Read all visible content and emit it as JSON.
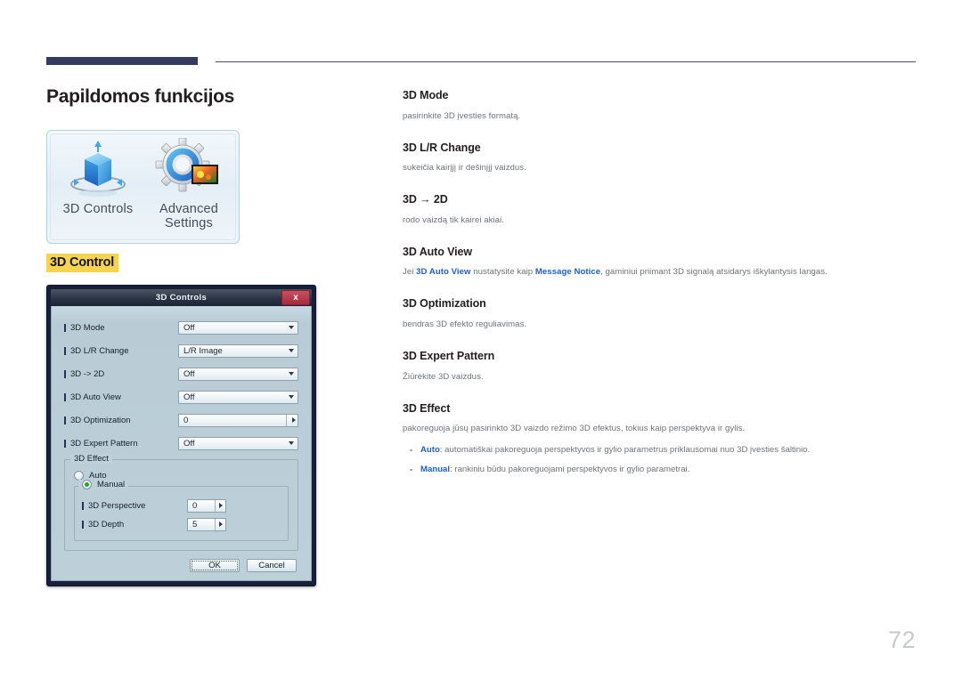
{
  "page": {
    "title": "Papildomos funkcijos",
    "number": "72",
    "accent_navy": "#343b5e",
    "highlight_yellow": "#f6d44f",
    "keyword_blue": "#1c5fd0"
  },
  "illustration": {
    "tiles": [
      {
        "icon": "3d-cube-icon",
        "caption": "3D Controls"
      },
      {
        "icon": "gear-picture-icon",
        "caption_line1": "Advanced",
        "caption_line2": "Settings"
      }
    ],
    "highlight_label": "3D Control"
  },
  "dialog": {
    "title": "3D Controls",
    "close_label": "x",
    "rows": [
      {
        "label": "3D Mode",
        "value": "Off",
        "control": "dropdown"
      },
      {
        "label": "3D L/R Change",
        "value": "L/R Image",
        "control": "dropdown"
      },
      {
        "label": "3D -> 2D",
        "value": "Off",
        "control": "dropdown"
      },
      {
        "label": "3D Auto View",
        "value": "Off",
        "control": "dropdown"
      },
      {
        "label": "3D Optimization",
        "value": "0",
        "control": "spinner"
      },
      {
        "label": "3D Expert Pattern",
        "value": "Off",
        "control": "dropdown"
      }
    ],
    "effect_group": {
      "legend": "3D Effect",
      "auto_label": "Auto",
      "auto_selected": false,
      "manual_label": "Manual",
      "manual_selected": true,
      "manual_rows": [
        {
          "label": "3D Perspective",
          "value": "0"
        },
        {
          "label": "3D Depth",
          "value": "5"
        }
      ]
    },
    "buttons": {
      "ok": "OK",
      "cancel": "Cancel"
    }
  },
  "sections": [
    {
      "title": "3D Mode",
      "body": "pasirinkite 3D įvesties formatą."
    },
    {
      "title": "3D L/R Change",
      "body": "sukeičia kairįjį ir dešinįjį vaizdus."
    },
    {
      "title": "3D → 2D",
      "body": "rodo vaizdą tik kairei akiai."
    },
    {
      "title": "3D Auto View",
      "body_parts": [
        {
          "text": "Jei ",
          "style": "normal"
        },
        {
          "text": "3D Auto View",
          "style": "keyword"
        },
        {
          "text": " nustatysite kaip ",
          "style": "normal"
        },
        {
          "text": "Message Notice",
          "style": "keyword"
        },
        {
          "text": ", gaminiui priimant 3D signalą atsidarys iškylantysis langas.",
          "style": "normal"
        }
      ]
    },
    {
      "title": "3D Optimization",
      "body": "bendras 3D efekto reguliavimas."
    },
    {
      "title": "3D Expert Pattern",
      "body": "Žiūrėkite 3D vaizdus."
    },
    {
      "title": "3D Effect",
      "body": "pakoreguoja jūsų pasirinkto 3D vaizdo režimo 3D efektus, tokius kaip perspektyva ir gylis.",
      "bullets": [
        {
          "keyword": "Auto",
          "text": ": automatiškai pakoreguoja perspektyvos ir gylio parametrus priklausomai nuo 3D įvesties šaltinio."
        },
        {
          "keyword": "Manual",
          "text": ": rankiniu būdu pakoreguojami perspektyvos ir gylio parametrai."
        }
      ]
    }
  ]
}
